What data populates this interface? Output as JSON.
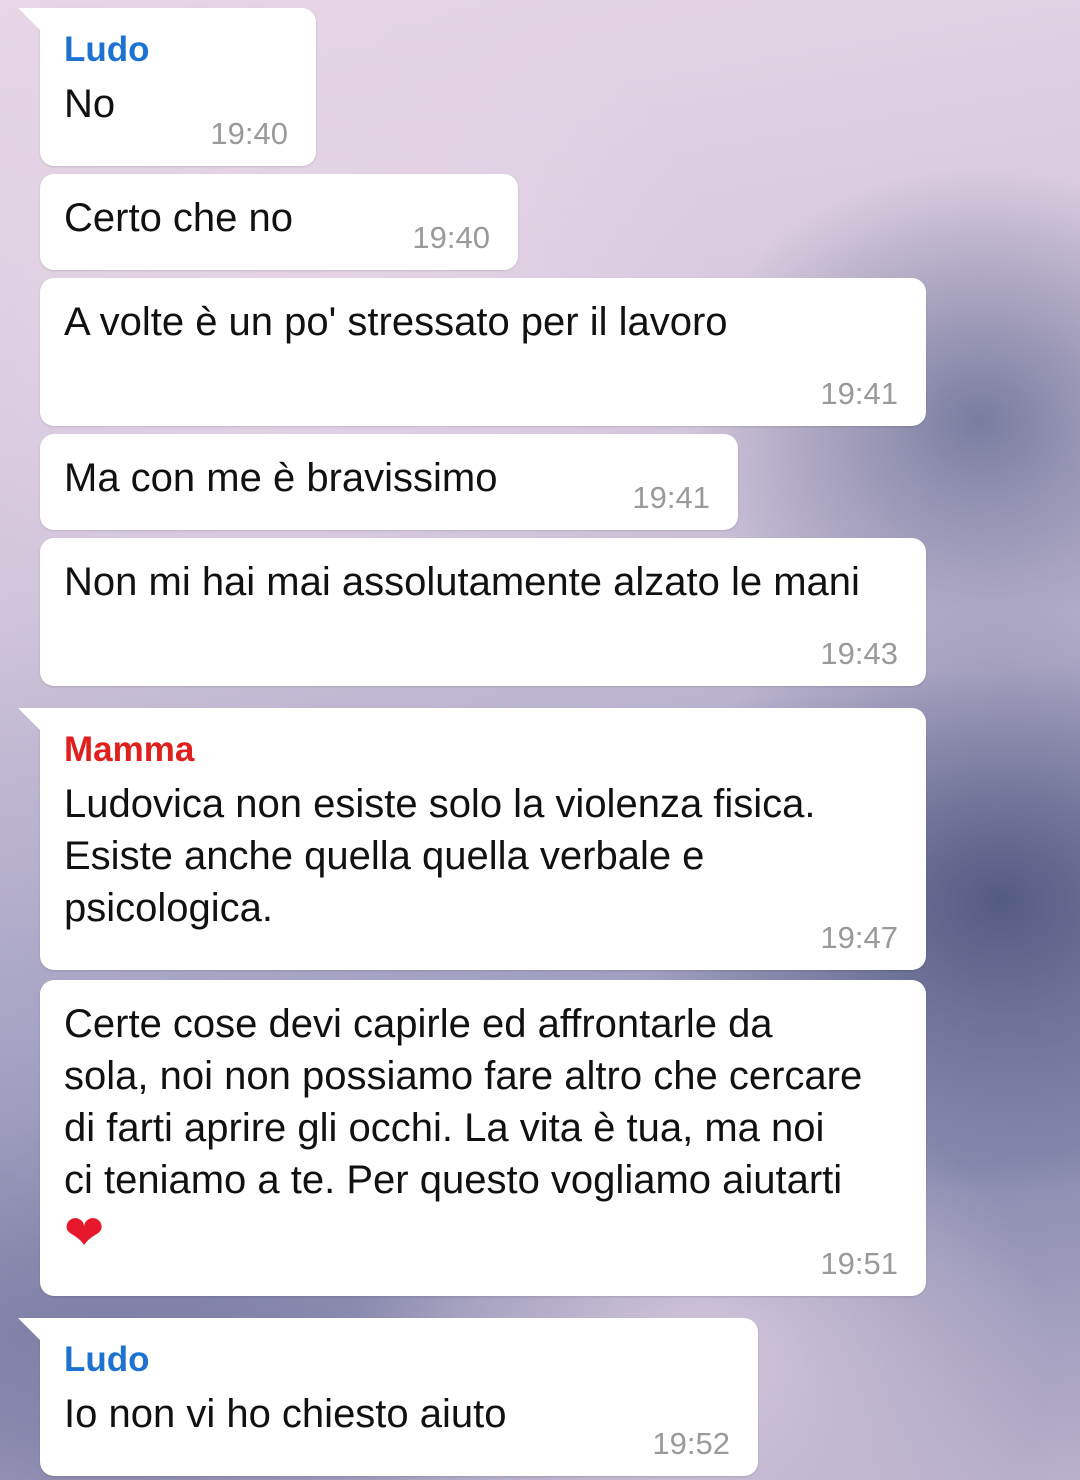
{
  "messages": [
    {
      "sender": "Ludo",
      "sender_color": "#1e73d2",
      "text": "No",
      "time": "19:40"
    },
    {
      "sender": "",
      "text": "Certo che no",
      "time": "19:40"
    },
    {
      "sender": "",
      "text": "A volte è un po' stressato per il lavoro",
      "time": "19:41"
    },
    {
      "sender": "",
      "text": "Ma con me è bravissimo",
      "time": "19:41"
    },
    {
      "sender": "",
      "text": "Non mi hai mai assolutamente alzato le mani",
      "time": "19:43"
    },
    {
      "sender": "Mamma",
      "sender_color": "#e0201c",
      "text": "Ludovica non esiste solo la violenza fisica. Esiste anche quella quella verbale e psicologica.",
      "time": "19:47"
    },
    {
      "sender": "",
      "text": "Certe cose devi capirle ed affrontarle da sola, noi non possiamo fare altro che cercare di farti aprire gli occhi. La vita è tua, ma noi ci teniamo a te. Per questo vogliamo aiutarti",
      "emoji": "❤",
      "emoji_name": "red-heart",
      "time": "19:51"
    },
    {
      "sender": "Ludo",
      "sender_color": "#1e73d2",
      "text": "Io non vi ho chiesto aiuto",
      "time": "19:52"
    }
  ]
}
